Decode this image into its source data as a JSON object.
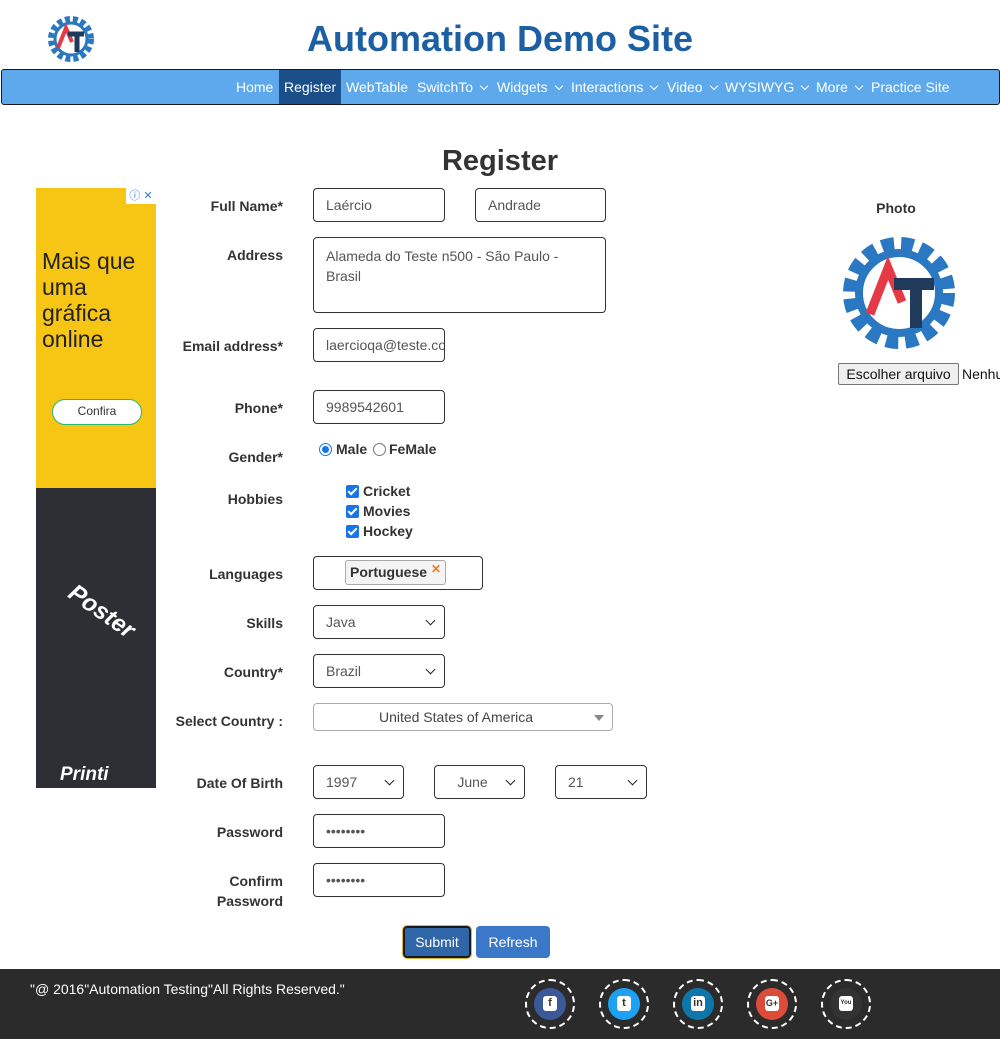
{
  "header": {
    "title": "Automation Demo Site"
  },
  "nav": {
    "items": [
      {
        "label": "Home"
      },
      {
        "label": "Register"
      },
      {
        "label": "WebTable"
      },
      {
        "label": "SwitchTo"
      },
      {
        "label": "Widgets"
      },
      {
        "label": "Interactions"
      },
      {
        "label": "Video"
      },
      {
        "label": "WYSIWYG"
      },
      {
        "label": "More"
      },
      {
        "label": "Practice Site"
      }
    ]
  },
  "page": {
    "heading": "Register"
  },
  "ad": {
    "text": "Mais que uma gráfica online",
    "button": "Confira",
    "poster": "Poster",
    "brand": "Printi"
  },
  "form": {
    "full_name_label": "Full Name*",
    "first_name": "Laércio",
    "last_name": "Andrade",
    "address_label": "Address",
    "address": "Alameda do Teste n500 - São Paulo - Brasil",
    "email_label": "Email address*",
    "email": "laercioqa@teste.com",
    "phone_label": "Phone*",
    "phone": "9989542601",
    "gender_label": "Gender*",
    "gender_options": [
      "Male",
      "FeMale"
    ],
    "gender_selected": "Male",
    "hobbies_label": "Hobbies",
    "hobbies": [
      "Cricket",
      "Movies",
      "Hockey"
    ],
    "languages_label": "Languages",
    "languages_selected": [
      "Portuguese"
    ],
    "skills_label": "Skills",
    "skills_value": "Java",
    "country_label": "Country*",
    "country_value": "Brazil",
    "select_country_label": "Select Country :",
    "select_country_value": "United States of America",
    "dob_label": "Date Of Birth",
    "dob_year": "1997",
    "dob_month": "June",
    "dob_day": "21",
    "password_label": "Password",
    "password_mask": "••••••••",
    "confirm_password_label": "Confirm Password",
    "confirm_password_mask": "••••••••",
    "submit_label": "Submit",
    "refresh_label": "Refresh"
  },
  "photo": {
    "label": "Photo",
    "file_button": "Escolher arquivo",
    "file_status": "Nenhum arquivo escolhido"
  },
  "footer": {
    "copyright": "\"@ 2016\"Automation Testing\"All Rights Reserved.\"",
    "social": [
      {
        "icon": "facebook-icon",
        "color": "#3b5998",
        "glyph": "f"
      },
      {
        "icon": "twitter-icon",
        "color": "#1da1f2",
        "glyph": "t"
      },
      {
        "icon": "linkedin-icon",
        "color": "#0e76a8",
        "glyph": "in"
      },
      {
        "icon": "googleplus-icon",
        "color": "#dd4b39",
        "glyph": "G+"
      },
      {
        "icon": "youtube-icon",
        "color": "#333333",
        "glyph": "You"
      }
    ]
  }
}
